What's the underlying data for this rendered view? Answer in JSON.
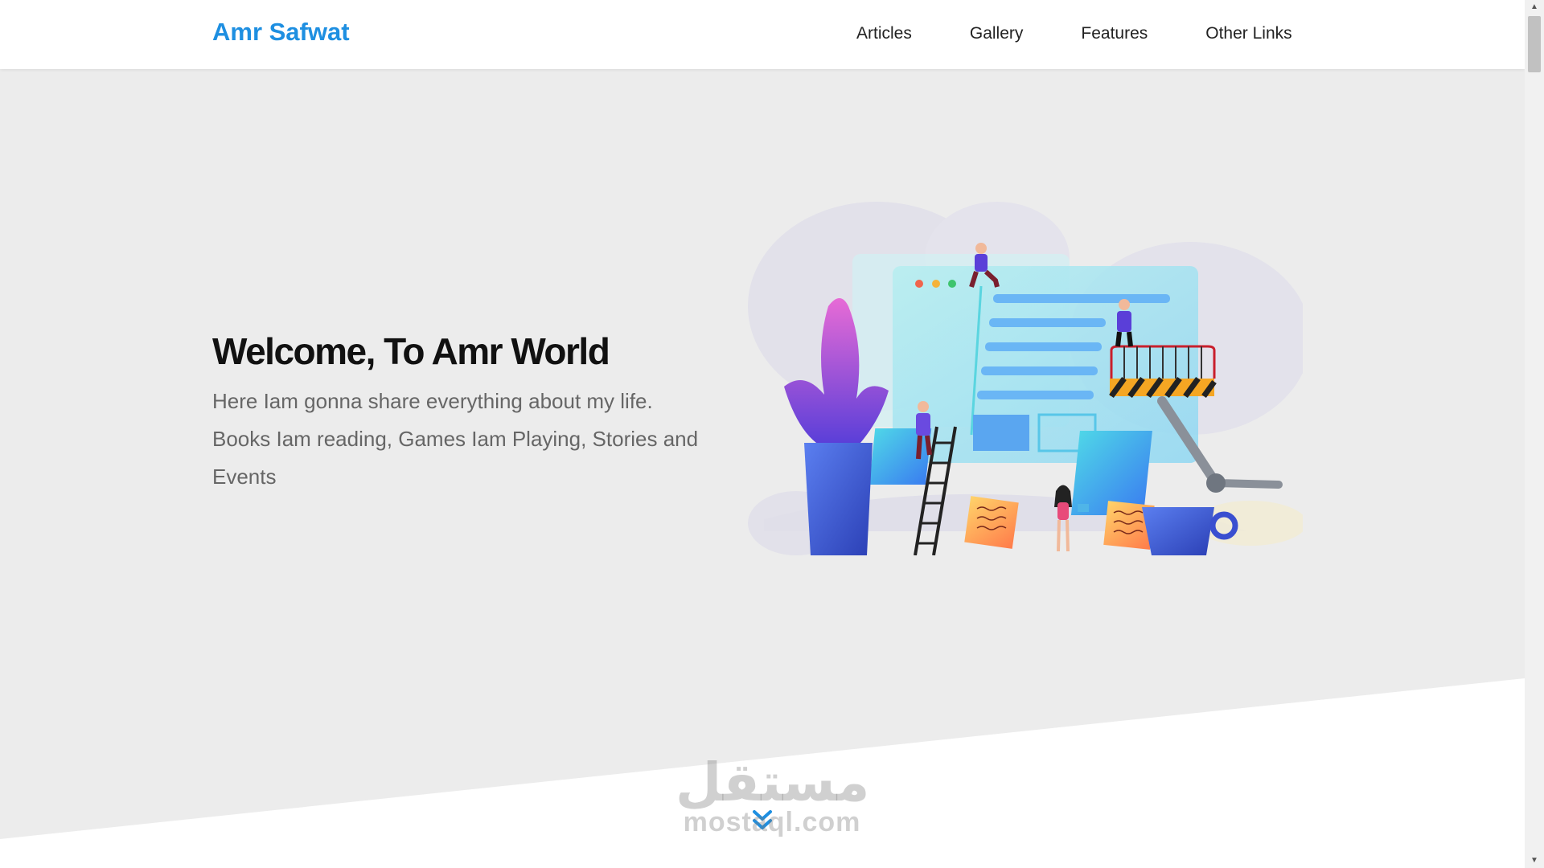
{
  "header": {
    "logo": "Amr Safwat",
    "nav": [
      "Articles",
      "Gallery",
      "Features",
      "Other Links"
    ]
  },
  "hero": {
    "title": "Welcome, To Amr World",
    "text": "Here Iam gonna share everything about my life. Books Iam reading, Games Iam Playing, Stories and Events"
  },
  "watermark": {
    "arabic": "مستقل",
    "latin": "mostaql.com"
  },
  "icons": {
    "scroll_down": "chevrons-down-icon",
    "scroll_up": "triangle-up-icon",
    "scroll_down_arrow": "triangle-down-icon"
  },
  "colors": {
    "brand": "#1e8fe1",
    "hero_bg": "#ececec",
    "heading": "#111111",
    "body_text": "#666666"
  }
}
